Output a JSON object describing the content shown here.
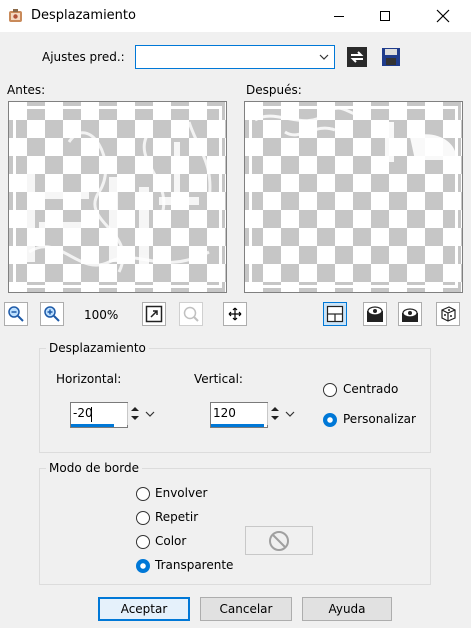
{
  "window": {
    "title": "Desplazamiento"
  },
  "presets": {
    "label": "Ajustes pred.:",
    "value": ""
  },
  "preview": {
    "before_label": "Antes:",
    "after_label": "Después:",
    "zoom_level": "100%"
  },
  "offset_group": {
    "title": "Desplazamiento",
    "horizontal_label": "Horizontal:",
    "horizontal_value": "-20",
    "vertical_label": "Vertical:",
    "vertical_value": "120",
    "centered_label": "Centrado",
    "custom_label": "Personalizar",
    "selected": "Personalizar"
  },
  "edge_group": {
    "title": "Modo de borde",
    "wrap_label": "Envolver",
    "repeat_label": "Repetir",
    "color_label": "Color",
    "transparent_label": "Transparente",
    "selected": "Transparente"
  },
  "buttons": {
    "ok": "Aceptar",
    "cancel": "Cancelar",
    "help": "Ayuda"
  },
  "colors": {
    "accent": "#0078d7",
    "background": "#f0f0f0",
    "checker": "#c6c6c6"
  }
}
